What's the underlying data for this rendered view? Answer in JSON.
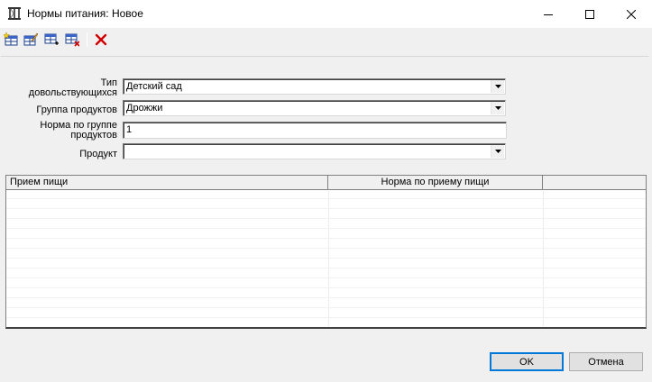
{
  "window": {
    "title": "Нормы питания: Новое",
    "app_icon": "columns-building-icon",
    "controls": [
      "minimize-icon",
      "maximize-icon",
      "close-icon"
    ]
  },
  "toolbar": {
    "buttons": [
      {
        "name": "new-record",
        "icon": "table-star-icon"
      },
      {
        "name": "edit-record",
        "icon": "table-edit-icon"
      },
      {
        "name": "add-row",
        "icon": "table-add-icon"
      },
      {
        "name": "delete-row",
        "icon": "table-delete-icon"
      },
      {
        "name": "delete",
        "icon": "red-x-icon"
      }
    ]
  },
  "form": {
    "type_label_1": "Тип",
    "type_label_2": "довольствующихся",
    "type_value": "Детский сад",
    "group_label": "Группа продуктов",
    "group_value": "Дрожжи",
    "norm_label_1": "Норма по группе",
    "norm_label_2": "продуктов",
    "norm_value": "1",
    "product_label": "Продукт",
    "product_value": ""
  },
  "grid": {
    "columns": [
      "Прием пищи",
      "Норма по приему пищи",
      ""
    ],
    "rows": []
  },
  "buttons": {
    "ok": "OK",
    "cancel": "Отмена"
  },
  "colors": {
    "window_bg": "#f0f0f0",
    "accent": "#0078d7",
    "delete_red": "#d00000"
  }
}
